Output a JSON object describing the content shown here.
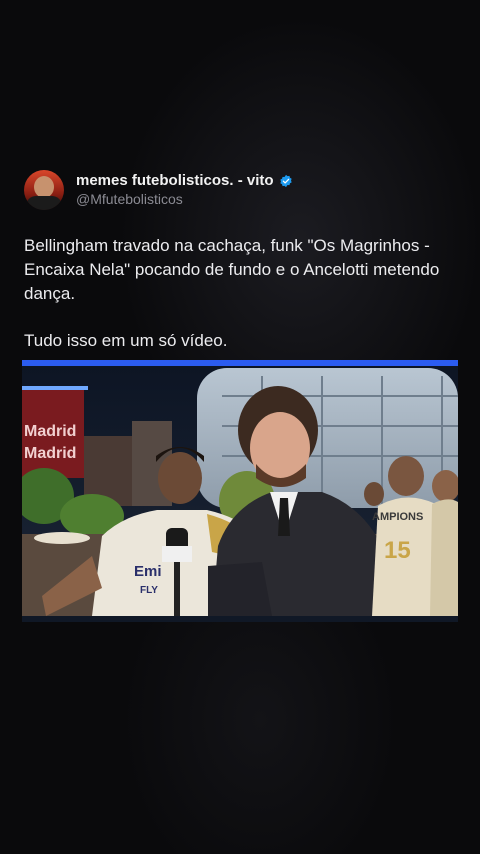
{
  "tweet": {
    "display_name": "memes futebolisticos. - vito",
    "handle": "@Mfutebolisticos",
    "avatar_icon": "profile-avatar",
    "verified_icon": "verified-badge-icon",
    "verified_color": "#1d9bf0",
    "text_line_1": "Bellingham travado na cachaça, funk \"Os Magrinhos - Encaixa Nela\" pocando de fundo e o Ancelotti metendo dança.",
    "text_line_2": "Tudo isso em um só vídeo."
  },
  "video": {
    "accent_color": "#2b5cf0",
    "sign_text_1": "Madrid",
    "sign_text_2": "Madrid",
    "shirt_text": "Emi",
    "shirt_text_2": "FLY",
    "fan_shirt_text": "AMPIONS",
    "fan_shirt_number": "15"
  }
}
